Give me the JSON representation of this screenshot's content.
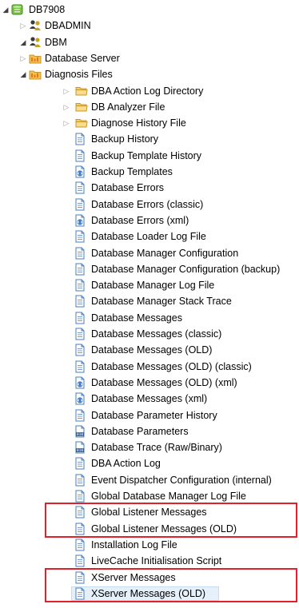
{
  "tree": [
    {
      "label": "DB7908",
      "icon": "database-icon",
      "depth": 0,
      "arrow": "expanded"
    },
    {
      "label": "DBADMIN",
      "icon": "users-icon",
      "depth": 1,
      "arrow": "collapsed"
    },
    {
      "label": "DBM",
      "icon": "users-icon",
      "depth": 1,
      "arrow": "expanded"
    },
    {
      "label": "Database Server",
      "icon": "folder-group-icon",
      "depth": 2,
      "arrow": "collapsed"
    },
    {
      "label": "Diagnosis Files",
      "icon": "folder-group-icon",
      "depth": 2,
      "arrow": "expanded"
    },
    {
      "label": "DBA Action Log Directory",
      "icon": "folder-icon",
      "depth": 3,
      "arrow": "collapsed"
    },
    {
      "label": "DB Analyzer File",
      "icon": "folder-icon",
      "depth": 3,
      "arrow": "collapsed"
    },
    {
      "label": "Diagnose History File",
      "icon": "folder-icon",
      "depth": 3,
      "arrow": "collapsed"
    },
    {
      "label": "Backup History",
      "icon": "document-icon",
      "depth": 3
    },
    {
      "label": "Backup Template History",
      "icon": "document-icon",
      "depth": 3
    },
    {
      "label": "Backup Templates",
      "icon": "xml-document-icon",
      "depth": 3
    },
    {
      "label": "Database Errors",
      "icon": "document-icon",
      "depth": 3
    },
    {
      "label": "Database Errors (classic)",
      "icon": "document-icon",
      "depth": 3
    },
    {
      "label": "Database Errors (xml)",
      "icon": "xml-document-icon",
      "depth": 3
    },
    {
      "label": "Database Loader  Log File",
      "icon": "document-icon",
      "depth": 3
    },
    {
      "label": "Database Manager Configuration",
      "icon": "document-icon",
      "depth": 3
    },
    {
      "label": "Database Manager Configuration (backup)",
      "icon": "document-icon",
      "depth": 3
    },
    {
      "label": "Database Manager Log File",
      "icon": "document-icon",
      "depth": 3
    },
    {
      "label": "Database Manager Stack Trace",
      "icon": "document-icon",
      "depth": 3
    },
    {
      "label": "Database Messages",
      "icon": "document-icon",
      "depth": 3
    },
    {
      "label": "Database Messages (classic)",
      "icon": "document-icon",
      "depth": 3
    },
    {
      "label": "Database Messages (OLD)",
      "icon": "document-icon",
      "depth": 3
    },
    {
      "label": "Database Messages (OLD) (classic)",
      "icon": "document-icon",
      "depth": 3
    },
    {
      "label": "Database Messages (OLD) (xml)",
      "icon": "xml-document-icon",
      "depth": 3
    },
    {
      "label": "Database Messages (xml)",
      "icon": "xml-document-icon",
      "depth": 3
    },
    {
      "label": "Database Parameter History",
      "icon": "document-icon",
      "depth": 3
    },
    {
      "label": "Database Parameters",
      "icon": "binary-document-icon",
      "depth": 3
    },
    {
      "label": "Database Trace (Raw/Binary)",
      "icon": "binary-document-icon",
      "depth": 3
    },
    {
      "label": "DBA Action Log",
      "icon": "document-icon",
      "depth": 3
    },
    {
      "label": "Event Dispatcher Configuration (internal)",
      "icon": "document-icon",
      "depth": 3
    },
    {
      "label": "Global Database Manager Log File",
      "icon": "document-icon",
      "depth": 3
    },
    {
      "label": "Global Listener Messages",
      "icon": "document-icon",
      "depth": 3
    },
    {
      "label": "Global Listener Messages (OLD)",
      "icon": "document-icon",
      "depth": 3
    },
    {
      "label": "Installation Log File",
      "icon": "document-icon",
      "depth": 3
    },
    {
      "label": "LiveCache Initialisation Script",
      "icon": "document-icon",
      "depth": 3
    },
    {
      "label": "XServer Messages",
      "icon": "document-icon",
      "depth": 3
    },
    {
      "label": "XServer Messages (OLD)",
      "icon": "document-icon",
      "depth": 3,
      "selected": true
    }
  ],
  "highlight_groups": [
    [
      "Global Listener Messages",
      "Global Listener Messages (OLD)"
    ],
    [
      "XServer Messages",
      "XServer Messages (OLD)"
    ]
  ],
  "colors": {
    "highlight_box": "#e0202a",
    "selection_bg": "#e6f0fb",
    "folder": "#f2c14e",
    "document": "#4a7dbf"
  }
}
